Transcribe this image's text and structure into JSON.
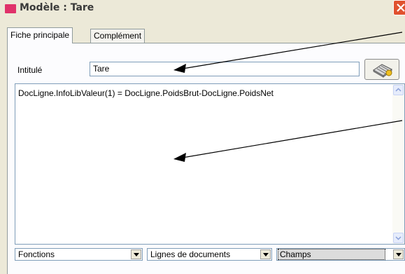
{
  "window": {
    "title": "Modèle : Tare"
  },
  "tabs": [
    {
      "label": "Fiche principale",
      "active": true
    },
    {
      "label": "Complément",
      "active": false
    }
  ],
  "form": {
    "intitule_label": "Intitulé",
    "intitule_value": "Tare"
  },
  "editor": {
    "content": "DocLigne.InfoLibValeur(1) = DocLigne.PoidsBrut-DocLigne.PoidsNet"
  },
  "dropdowns": [
    {
      "selected": "Fonctions"
    },
    {
      "selected": "Lignes de documents"
    },
    {
      "selected": "Champs"
    }
  ],
  "icons": {
    "title": "app-icon",
    "close": "close-icon",
    "calculator": "calculator-icon",
    "dropdown": "chevron-down-icon"
  },
  "colors": {
    "window_bg": "#ece9d8",
    "title_icon": "#e0326a",
    "close_button": "#e0512f",
    "input_border": "#7f9db9"
  }
}
